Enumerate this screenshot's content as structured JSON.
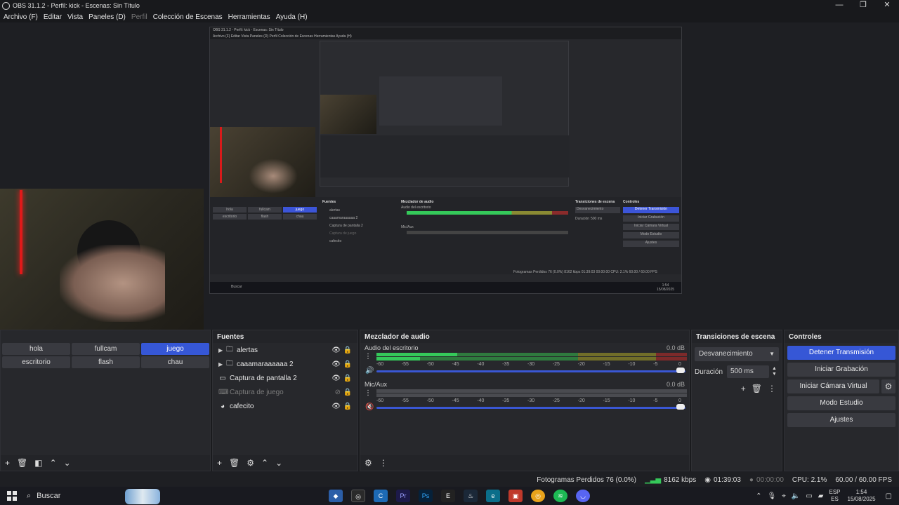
{
  "window": {
    "title": "OBS 31.1.2 - Perfil: kick - Escenas: Sin Título",
    "min": "—",
    "max": "❐",
    "close": "✕"
  },
  "menu": [
    "Archivo (F)",
    "Editar",
    "Vista",
    "Paneles (D)",
    "Perfil",
    "Colección de Escenas",
    "Herramientas",
    "Ayuda (H)"
  ],
  "nested": {
    "title": "OBS 31.1.2 - Perfil: kick - Escenas: Sin Título",
    "menu": "Archivo (F)   Editar   Vista   Paneles (D)   Perfil   Colección de Escenas   Herramientas   Ayuda (H)",
    "scenes": [
      "hola",
      "fullcam",
      "juego",
      "escritorio",
      "flash",
      "chau"
    ],
    "sources": [
      "alertas",
      "caaamaraaaaaa 2",
      "Captura de pantalla 2",
      "Captura de juego",
      "cafecito"
    ],
    "docks": {
      "sources": "Fuentes",
      "mixer": "Mezclador de audio",
      "transitions": "Transiciones de escena",
      "controls": "Controles"
    },
    "track1": "Audio del escritorio",
    "track2": "Mic/Aux",
    "transition": "Desvanecimiento",
    "duration": "Duración",
    "duration_val": "500 ms",
    "buttons": [
      "Detener Transmisión",
      "Iniciar Grabación",
      "Iniciar Cámara Virtual",
      "Modo Estudio",
      "Ajustes"
    ],
    "status": "Fotogramas Perdidos 76 (0.0%)   8162 kbps   01:39:03   00:00:00   CPU: 2.1%   60.00 / 60.00 FPS",
    "search": "Buscar",
    "clock": "1:54",
    "date": "15/08/2025"
  },
  "scenes": {
    "items": [
      {
        "label": "hola",
        "active": false
      },
      {
        "label": "fullcam",
        "active": false
      },
      {
        "label": "juego",
        "active": true
      },
      {
        "label": "escritorio",
        "active": false
      },
      {
        "label": "flash",
        "active": false
      },
      {
        "label": "chau",
        "active": false
      }
    ]
  },
  "sources": {
    "title": "Fuentes",
    "items": [
      {
        "label": "alertas",
        "icon": "folder-icon",
        "group": true,
        "dim": false
      },
      {
        "label": "caaamaraaaaaa 2",
        "icon": "folder-icon",
        "group": true,
        "dim": false
      },
      {
        "label": "Captura de pantalla 2",
        "icon": "monitor-icon",
        "group": false,
        "dim": false
      },
      {
        "label": "Captura de juego",
        "icon": "gamepad-icon",
        "group": false,
        "dim": true
      },
      {
        "label": "cafecito",
        "icon": "browser-icon",
        "group": false,
        "dim": false
      }
    ]
  },
  "mixer": {
    "title": "Mezclador de audio",
    "tracks": [
      {
        "name": "Audio del escritorio",
        "db": "0.0 dB",
        "muted": false,
        "level": 0.42
      },
      {
        "name": "Mic/Aux",
        "db": "0.0 dB",
        "muted": true,
        "level": 0.0
      }
    ],
    "scale": [
      "-60",
      "-55",
      "-50",
      "-45",
      "-40",
      "-35",
      "-30",
      "-25",
      "-20",
      "-15",
      "-10",
      "-5",
      "0"
    ]
  },
  "transitions": {
    "title": "Transiciones de escena",
    "selected": "Desvanecimiento",
    "duration_label": "Duración",
    "duration_value": "500 ms"
  },
  "controls": {
    "title": "Controles",
    "stop_stream": "Detener Transmisión",
    "start_record": "Iniciar Grabación",
    "virtual_cam": "Iniciar Cámara Virtual",
    "studio_mode": "Modo Estudio",
    "settings": "Ajustes"
  },
  "status": {
    "dropped": "Fotogramas Perdidos 76 (0.0%)",
    "bitrate": "8162 kbps",
    "stream_time": "01:39:03",
    "record_time": "00:00:00",
    "cpu": "CPU: 2.1%",
    "fps": "60.00 / 60.00 FPS"
  },
  "taskbar": {
    "search": "Buscar",
    "lang1": "ESP",
    "lang2": "ES",
    "time": "1:54",
    "date": "15/08/2025"
  },
  "colors": {
    "accent": "#3657d6",
    "meter_green": "#35c95a",
    "meter_yellow": "#c9c135",
    "meter_red": "#c93535"
  }
}
